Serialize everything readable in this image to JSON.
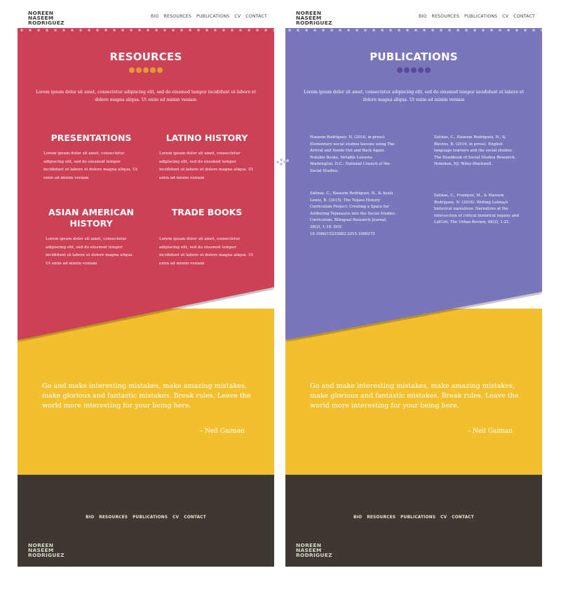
{
  "logo": {
    "lines": [
      "NOREEN",
      "NASEEM",
      "RODRIGUEZ"
    ]
  },
  "nav": [
    "BIO",
    "RESOURCES",
    "PUBLICATIONS",
    "CV",
    "CONTACT"
  ],
  "colors": {
    "resources_bg": "#cc4155",
    "publications_bg": "#7a76bb",
    "quote_bg": "#f2bf2f",
    "footer_bg": "#3d3832",
    "resources_dot": "#e59a35",
    "publications_dot": "#5a4a98"
  },
  "resources": {
    "title": "RESOURCES",
    "intro": "Lorem ipsum dolor sit amet, consectetur adipiscing elit, sed do eiusmod tempor incididunt ut labore et dolore magna aliqua. Ut enim ad minim veniam",
    "items": [
      {
        "title": "PRESENTATIONS",
        "body": "Lorem ipsum dolor sit amet, consectetur adipiscing elit, sed do eiusmod tempor incididunt ut labore et dolore magna aliqua. Ut enim ad minim veniam"
      },
      {
        "title": "LATINO HISTORY",
        "body": "Lorem ipsum dolor sit amet, consectetur adipiscing elit, sed do eiusmod tempor incididunt ut labore et dolore magna aliqua. Ut enim ad minim veniam"
      },
      {
        "title": "ASIAN AMERICAN HISTORY",
        "body": "Lorem ipsum dolor sit amet, consectetur adipiscing elit, sed do eiusmod tempor incididunt ut labore et dolore magna aliqua. Ut enim ad minim veniam"
      },
      {
        "title": "TRADE BOOKS",
        "body": "Lorem ipsum dolor sit amet, consectetur adipiscing elit, sed do eiusmod tempor incididunt ut labore et dolore magna aliqua. Ut enim ad minim veniam"
      }
    ]
  },
  "publications": {
    "title": "PUBLICATIONS",
    "intro": "Lorem ipsum dolor sit amet, consectetur adipiscing elit, sed do eiusmod tempor incididunt ut labore et dolore magna aliqua. Ut enim ad minim veniam",
    "items": [
      "Naseem Rodríguez, N. (2016, in press). Elementary social studies lessons using The Arrival and Inside Out and Back Again. Notable Books, Notable Lessons. Washington, D.C.: National Council of the Social Studies.",
      "Salinas, C., Naseem Rodríguez, N., & Blevins, B. (2016, in press). English language learners and the social studies. The Handbook of Social Studies Research. Hoboken, NJ: Wiley-Blackwell.",
      "Salinas, C., Naseem Rodríguez, N., & Ayala Lewis, B. (2015). The Tejano History Curriculum Project: Creating a Space for Authoring Tejanas/os into the Social Studies Curriculum. Bilingual Research Journal, 38(2), 1-18. DOI: 10.1080/15235882.2015.1066275",
      "Salinas, C., Franquiz, M., & Naseem Rodríguez, N. (2016). Writing Latina/o historical narratives: Narratives at the intersection of critical historical inquiry and LatCrit. The Urban Review, 48(2), 1-21."
    ]
  },
  "quote": {
    "text": "Go and make interesting mistakes, make amazing mistakes, make glorious and fantastic mistakes. Break rules. Leave the world more interesting for your being here.",
    "author": "– Neil Gaiman"
  }
}
